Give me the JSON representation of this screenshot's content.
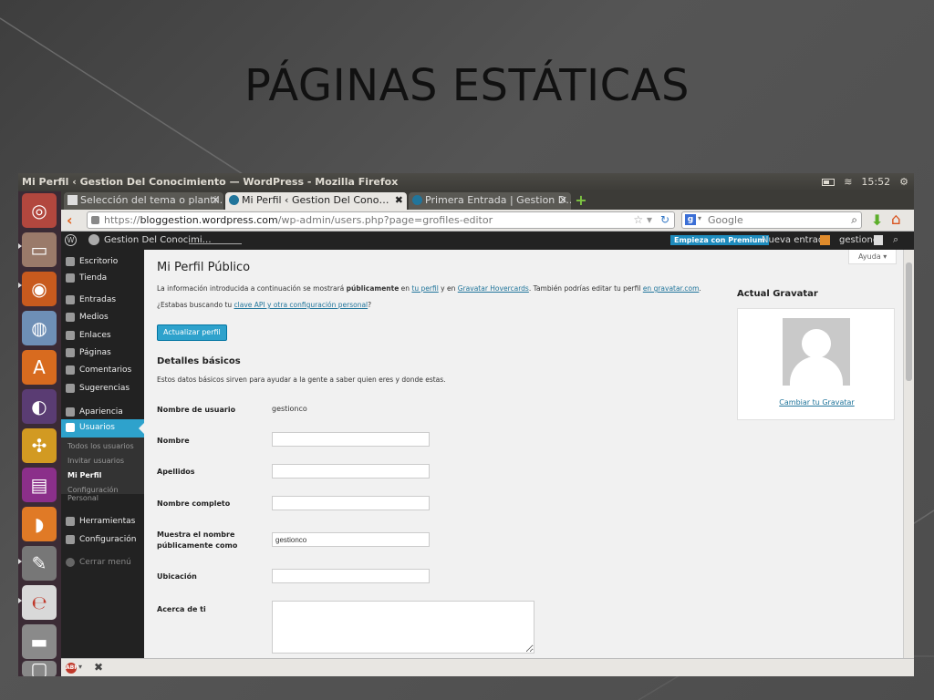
{
  "slide": {
    "title": "PÁGINAS ESTÁTICAS"
  },
  "window": {
    "title": "Mi Perfil ‹ Gestion Del Conocimiento — WordPress - Mozilla Firefox",
    "clock": "15:52"
  },
  "tabs": [
    {
      "label": "Selección del tema o plantil…",
      "close": "✕"
    },
    {
      "label": "Mi Perfil ‹ Gestion Del Cono…",
      "close": "✖"
    },
    {
      "label": "Primera Entrada | Gestion D…",
      "close": "✕"
    }
  ],
  "navbar": {
    "url_scheme": "https://",
    "url_host": "bloggestion.wordpress.com",
    "url_path": "/wp-admin/users.php?page=grofiles-editor",
    "search_placeholder": "Google"
  },
  "adminbar": {
    "site_name": "Gestion Del Conocimi…",
    "premium": "Empieza con Premium",
    "new_post": "Nueva entrada",
    "user": "gestionco"
  },
  "menu": {
    "items": [
      {
        "label": "Escritorio"
      },
      {
        "label": "Tienda"
      },
      {
        "label": "Entradas"
      },
      {
        "label": "Medios"
      },
      {
        "label": "Enlaces"
      },
      {
        "label": "Páginas"
      },
      {
        "label": "Comentarios"
      },
      {
        "label": "Sugerencias"
      },
      {
        "label": "Apariencia"
      },
      {
        "label": "Usuarios"
      },
      {
        "label": "Herramientas"
      },
      {
        "label": "Configuración"
      },
      {
        "label": "Cerrar menú"
      }
    ],
    "submenu": [
      {
        "label": "Todos los usuarios"
      },
      {
        "label": "Invitar usuarios"
      },
      {
        "label": "Mi Perfil"
      },
      {
        "label": "Configuración Personal"
      }
    ]
  },
  "content": {
    "help": "Ayuda",
    "heading": "Mi Perfil Público",
    "intro1_a": "La información introducida a continuación se mostrará ",
    "intro1_b": "públicamente",
    "intro1_c": " en ",
    "intro1_link1": "tu perfil",
    "intro1_d": " y en ",
    "intro1_link2": "Gravatar Hovercards",
    "intro1_e": ". También podrías editar tu perfil ",
    "intro1_link3": "en gravatar.com",
    "intro1_f": ".",
    "intro2_a": "¿Estabas buscando tu ",
    "intro2_link": "clave API y otra configuración personal",
    "intro2_b": "?",
    "update_button": "Actualizar perfil",
    "section_title": "Detalles básicos",
    "section_desc": "Estos datos básicos sirven para ayudar a la gente a saber quien eres y donde estas.",
    "fields": {
      "username_label": "Nombre de usuario",
      "username_value": "gestionco",
      "first_name_label": "Nombre",
      "first_name_value": "",
      "last_name_label": "Apellidos",
      "last_name_value": "",
      "full_name_label": "Nombre completo",
      "full_name_value": "",
      "display_label_1": "Muestra el nombre",
      "display_label_2": "públicamente como",
      "display_value": "gestionco",
      "location_label": "Ubicación",
      "location_value": "",
      "about_label": "Acerca de ti"
    },
    "gravatar_title": "Actual Gravatar",
    "gravatar_link": "Cambiar tu Gravatar"
  },
  "colors": {
    "wp_blue": "#2ea2cc",
    "admin_dark": "#222222",
    "link": "#21759b",
    "launcher": "#3b2b35"
  }
}
